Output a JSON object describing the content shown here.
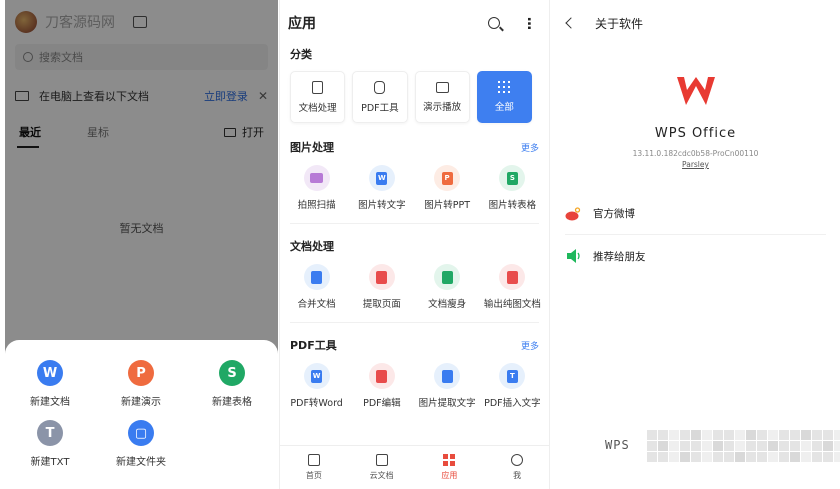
{
  "left": {
    "watermark": "刀客源码网",
    "search_placeholder": "搜索文档",
    "pc_notice": "在电脑上查看以下文档",
    "login": "立即登录",
    "close": "✕",
    "tabs": [
      "最近",
      "星标"
    ],
    "open": "打开",
    "empty": "暂无文档",
    "sheet": [
      {
        "label": "新建文档",
        "glyph": "W",
        "color": "#3a7cf0"
      },
      {
        "label": "新建演示",
        "glyph": "P",
        "color": "#ef6b3f"
      },
      {
        "label": "新建表格",
        "glyph": "S",
        "color": "#20a865"
      },
      {
        "label": "新建TXT",
        "glyph": "T",
        "color": "#8b94a8"
      },
      {
        "label": "新建文件夹",
        "glyph": "▢",
        "color": "#3a7cf0"
      }
    ]
  },
  "middle": {
    "title": "应用",
    "category_title": "分类",
    "categories": [
      "文档处理",
      "PDF工具",
      "演示播放",
      "全部"
    ],
    "more": "更多",
    "sections": [
      {
        "title": "图片处理",
        "has_more": true,
        "tools": [
          {
            "label": "拍照扫描",
            "bg": "#f2e8f7",
            "fg": "#b77ad6"
          },
          {
            "label": "图片转文字",
            "bg": "#e6f0fc",
            "fg": "#3a7cf0"
          },
          {
            "label": "图片转PPT",
            "bg": "#fdece4",
            "fg": "#ef6b3f"
          },
          {
            "label": "图片转表格",
            "bg": "#e3f5ec",
            "fg": "#20a865"
          }
        ]
      },
      {
        "title": "文档处理",
        "has_more": false,
        "tools": [
          {
            "label": "合并文档",
            "bg": "#e6f0fc",
            "fg": "#3a7cf0"
          },
          {
            "label": "提取页面",
            "bg": "#fce8e8",
            "fg": "#e84c4c"
          },
          {
            "label": "文档瘦身",
            "bg": "#e3f5ec",
            "fg": "#20a865"
          },
          {
            "label": "输出纯图文档",
            "bg": "#fce8e8",
            "fg": "#e84c4c"
          }
        ]
      },
      {
        "title": "PDF工具",
        "has_more": true,
        "tools": [
          {
            "label": "PDF转Word",
            "bg": "#e6f0fc",
            "fg": "#3a7cf0"
          },
          {
            "label": "PDF编辑",
            "bg": "#fce8e8",
            "fg": "#e84c4c"
          },
          {
            "label": "图片提取文字",
            "bg": "#e6f0fc",
            "fg": "#3a7cf0"
          },
          {
            "label": "PDF插入文字",
            "bg": "#e6f0fc",
            "fg": "#3a7cf0"
          }
        ]
      }
    ],
    "nav": [
      "首页",
      "云文档",
      "应用",
      "我"
    ]
  },
  "right": {
    "title": "关于软件",
    "brand": "WPS Office",
    "version": "13.11.0.182cdc0b58-ProCn00110",
    "parsley": "Parsley",
    "links": [
      "官方微博",
      "推荐给朋友"
    ],
    "footer_logo": "WPS"
  }
}
